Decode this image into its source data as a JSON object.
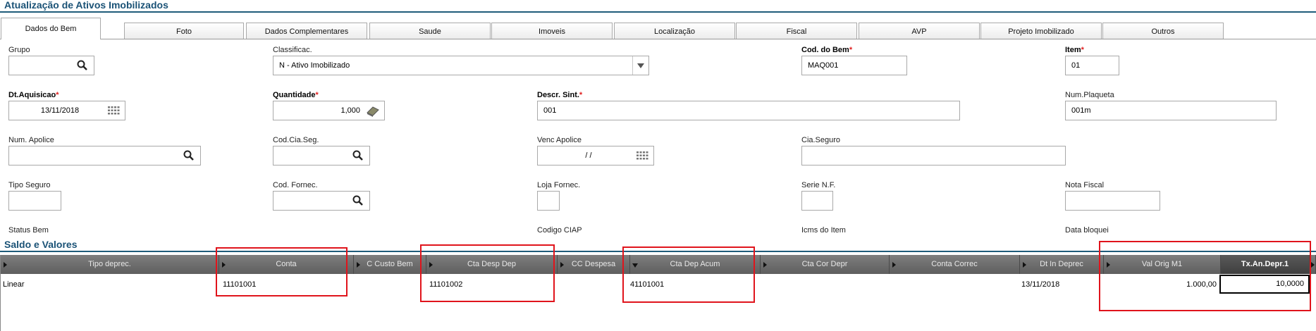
{
  "window": {
    "title": "Atualização de Ativos Imobilizados"
  },
  "tabs": [
    {
      "label": "Dados do Bem"
    },
    {
      "label": "Foto"
    },
    {
      "label": "Dados Complementares"
    },
    {
      "label": "Saude"
    },
    {
      "label": "Imoveis"
    },
    {
      "label": "Localização"
    },
    {
      "label": "Fiscal"
    },
    {
      "label": "AVP"
    },
    {
      "label": "Projeto Imobilizado"
    },
    {
      "label": "Outros"
    }
  ],
  "form": {
    "grupo": {
      "label": "Grupo",
      "value": ""
    },
    "classificac": {
      "label": "Classificac.",
      "value": "N - Ativo Imobilizado"
    },
    "cod_bem": {
      "label": "Cod. do Bem",
      "value": "MAQ001"
    },
    "item": {
      "label": "Item",
      "value": "01"
    },
    "dt_aquisicao": {
      "label": "Dt.Aquisicao",
      "value": "13/11/2018"
    },
    "quantidade": {
      "label": "Quantidade",
      "value": "1,000"
    },
    "descr_sint": {
      "label": "Descr. Sint.",
      "value": "001"
    },
    "num_plaqueta": {
      "label": "Num.Plaqueta",
      "value": "001m"
    },
    "num_apolice": {
      "label": "Num. Apolice",
      "value": ""
    },
    "cod_cia_seg": {
      "label": "Cod.Cia.Seg.",
      "value": ""
    },
    "venc_apolice": {
      "label": "Venc Apolice",
      "value": "/ /"
    },
    "cia_seguro": {
      "label": "Cia.Seguro",
      "value": ""
    },
    "tipo_seguro": {
      "label": "Tipo Seguro",
      "value": ""
    },
    "cod_fornec": {
      "label": "Cod. Fornec.",
      "value": ""
    },
    "loja_fornec": {
      "label": "Loja Fornec.",
      "value": ""
    },
    "serie_nf": {
      "label": "Serie N.F.",
      "value": ""
    },
    "nota_fiscal": {
      "label": "Nota Fiscal",
      "value": ""
    },
    "status_bem": {
      "label": "Status Bem"
    },
    "codigo_ciap": {
      "label": "Codigo CIAP"
    },
    "icms_item": {
      "label": "Icms do Item"
    },
    "data_bloquei": {
      "label": "Data bloquei"
    },
    "required_mark": "*"
  },
  "saldo": {
    "title": "Saldo e Valores",
    "columns": [
      "Tipo deprec.",
      "Conta",
      "C Custo Bem",
      "Cta Desp Dep",
      "CC Despesa",
      "Cta Dep Acum",
      "Cta Cor Depr",
      "Conta Correc",
      "Dt In Deprec",
      "Val Orig M1",
      "Tx.An.Depr.1"
    ],
    "row": {
      "tipo_deprec": "Linear",
      "conta": "11101001",
      "c_custo_bem": "",
      "cta_desp_dep": "11101002",
      "cc_despesa": "",
      "cta_dep_acum": "41101001",
      "cta_cor_depr": "",
      "conta_correc": "",
      "dt_in_deprec": "13/11/2018",
      "val_orig_m1": "1.000,00",
      "tx_an_depr1": "10,0000"
    }
  },
  "colors": {
    "accent": "#1f5c7a",
    "highlight": "#e0141c",
    "header": "#6e6e6e"
  }
}
